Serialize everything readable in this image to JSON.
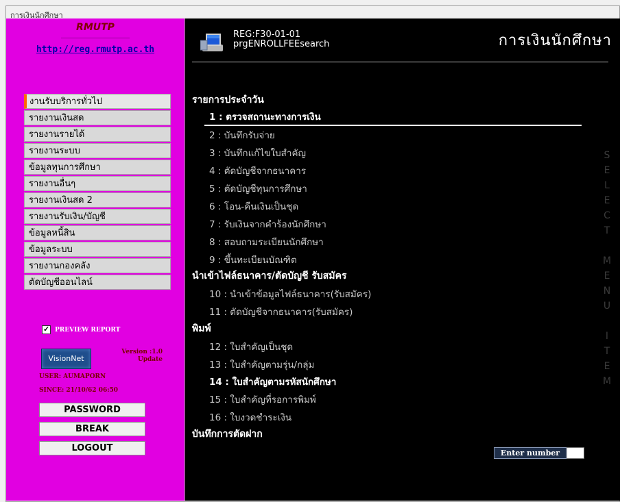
{
  "window": {
    "title": "การเงินนักศึกษา"
  },
  "sidebar": {
    "brand": "RMUTP",
    "link": "http://reg.rmutp.ac.th",
    "menu": [
      "งานรับบริการทั่วไป",
      "รายงานเงินสด",
      "รายงานรายได้",
      "รายงานระบบ",
      "ข้อมูลทุนการศึกษา",
      "รายงานอื่นๆ",
      "รายงานเงินสด 2",
      "รายงานรับเงิน/บัญชี",
      "ข้อมูลหนี้สิน",
      "ข้อมูลระบบ",
      "รายงานกองคลัง",
      "ตัดบัญชีออนไลน์"
    ],
    "preview_report": {
      "label": "PREVIEW REPORT",
      "checked": true,
      "mark": "✓"
    },
    "visionnet_label": "VisionNet",
    "version": "Version :1.0",
    "update": "Update",
    "user": "USER: AUMAPORN",
    "since": "SINCE: 21/10/62 06:50",
    "buttons": {
      "password": "PASSWORD",
      "break": "BREAK",
      "logout": "LOGOUT"
    }
  },
  "main": {
    "reg_code": "REG:F30-01-01",
    "program": "prgENROLLFEEsearch",
    "title": "การเงินนักศึกษา",
    "sections": [
      {
        "title": "รายการประจำวัน",
        "items": [
          {
            "label": "1 : ตรวจสถานะทางการเงิน",
            "highlight": true
          },
          {
            "label": "2 : บันทึกรับจ่าย",
            "highlight": false
          },
          {
            "label": "3 : บันทึกแก้ไขใบสำคัญ",
            "highlight": false
          },
          {
            "label": "4 : ตัดบัญชีจากธนาคาร",
            "highlight": false
          },
          {
            "label": "5 : ตัดบัญชีทุนการศึกษา",
            "highlight": false
          },
          {
            "label": "6 : โอน-คืนเงินเป็นชุด",
            "highlight": false
          },
          {
            "label": "7 : รับเงินจากคำร้องนักศึกษา",
            "highlight": false
          },
          {
            "label": "8 : สอบถามระเบียนนักศึกษา",
            "highlight": false
          },
          {
            "label": "9 : ขึ้นทะเบียนบัณฑิต",
            "highlight": false
          }
        ]
      },
      {
        "title": "นำเข้าไฟล์ธนาคาร/ตัดบัญชี รับสมัคร",
        "items": [
          {
            "label": "10 : นำเข้าข้อมูลไฟล์ธนาคาร(รับสมัคร)",
            "highlight": false
          },
          {
            "label": "11 : ตัดบัญชีจากธนาคาร(รับสมัคร)",
            "highlight": false
          }
        ]
      },
      {
        "title": "พิมพ์",
        "items": [
          {
            "label": "12 : ใบสำคัญเป็นชุด",
            "highlight": false
          },
          {
            "label": "13 : ใบสำคัญตามรุ่น/กลุ่ม",
            "highlight": false
          },
          {
            "label": "14 : ใบสำคัญตามรหัสนักศึกษา",
            "highlight": true
          },
          {
            "label": "15 : ใบสำคัญที่รอการพิมพ์",
            "highlight": false
          },
          {
            "label": "16 : ใบงวดชำระเงิน",
            "highlight": false
          }
        ]
      },
      {
        "title": "บันทึกการตัดฝาก",
        "items": []
      }
    ],
    "select_menu_letters": [
      "S",
      "E",
      "L",
      "E",
      "C",
      "T",
      "",
      "M",
      "E",
      "N",
      "U",
      "",
      "I",
      "T",
      "E",
      "M"
    ],
    "enter_number": {
      "label": "Enter number",
      "value": ""
    }
  }
}
